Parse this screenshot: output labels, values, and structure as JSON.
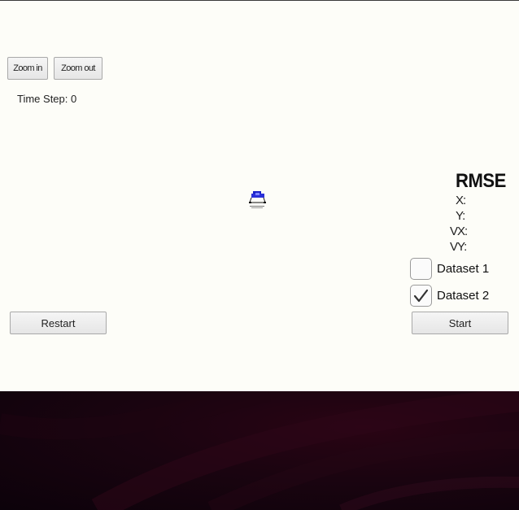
{
  "controls": {
    "zoom_in_label": "Zoom in",
    "zoom_out_label": "Zoom out",
    "restart_label": "Restart",
    "start_label": "Start"
  },
  "status": {
    "time_step_label": "Time Step:",
    "time_step_value": "0"
  },
  "rmse": {
    "title": "RMSE",
    "x_label": "X:",
    "y_label": "Y:",
    "vx_label": "VX:",
    "vy_label": "VY:"
  },
  "datasets": [
    {
      "label": "Dataset 1",
      "checked": false
    },
    {
      "label": "Dataset 2",
      "checked": true
    }
  ],
  "colors": {
    "background": "#fdfdf8",
    "car_blue": "#1a22c8",
    "desktop_dark": "#1a0410"
  },
  "icons": {
    "car": "car-icon",
    "checkmark": "checkmark-icon"
  }
}
